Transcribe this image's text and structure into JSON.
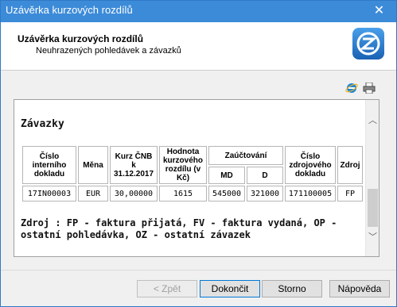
{
  "window": {
    "title": "Uzávěrka kurzových rozdílů",
    "close_label": "✕"
  },
  "header": {
    "title": "Uzávěrka kurzových rozdílů",
    "subtitle": "Neuhrazených pohledávek a závazků"
  },
  "report": {
    "section_title": "Závazky",
    "columns": {
      "cislo": "Číslo interního dokladu",
      "mena": "Měna",
      "kurz": "Kurz ČNB k 31.12.2017",
      "hodnota": "Hodnota kurzového rozdílu (v Kč)",
      "zauctovani": "Zaúčtování",
      "md": "MD",
      "d": "D",
      "zdroj_doklad": "Číslo zdrojového dokladu",
      "zdroj": "Zdroj"
    },
    "rows": [
      {
        "cislo": "17IN00003",
        "mena": "EUR",
        "kurz": "30,00000",
        "hodnota": "1615",
        "md": "545000",
        "d": "321000",
        "zdroj_doklad": "171100005",
        "zdroj": "FP"
      }
    ],
    "note": "Zdroj : FP - faktura přijatá, FV - faktura vydaná, OP - ostatní pohledávka, OZ - ostatní závazek"
  },
  "toolbar": {
    "icons": [
      "internet-explorer-icon",
      "print-icon"
    ]
  },
  "scrollbar": {
    "up": "︿",
    "down": "﹀"
  },
  "buttons": {
    "back": "< Zpět",
    "finish": "Dokončit",
    "cancel": "Storno",
    "help": "Nápověda"
  },
  "colors": {
    "titlebar": "#3c8bd9",
    "default_border": "#0078d7",
    "logo": "#1f74c8"
  }
}
